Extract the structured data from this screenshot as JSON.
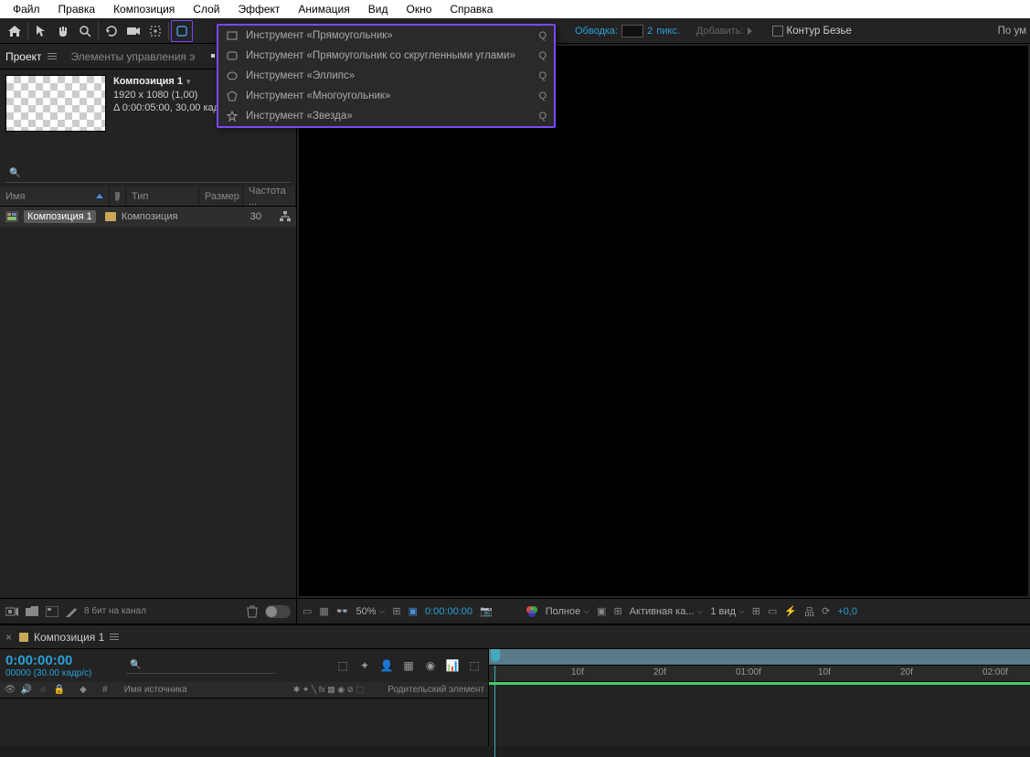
{
  "menubar": [
    "Файл",
    "Правка",
    "Композиция",
    "Слой",
    "Эффект",
    "Анимация",
    "Вид",
    "Окно",
    "Справка"
  ],
  "toolbar": {
    "stroke_label": "Обводка:",
    "stroke_value": "2",
    "stroke_unit": "пикс.",
    "add_label": "Добавить:",
    "bezier_checkbox": "Контур Безье",
    "right_hint": "По ум"
  },
  "shape_flyout": [
    {
      "icon": "rect",
      "label": "Инструмент «Прямоугольник»",
      "shortcut": "Q",
      "selected": false
    },
    {
      "icon": "roundrect",
      "label": "Инструмент «Прямоугольник со скругленными углами»",
      "shortcut": "Q",
      "selected": true
    },
    {
      "icon": "ellipse",
      "label": "Инструмент «Эллипс»",
      "shortcut": "Q",
      "selected": false
    },
    {
      "icon": "polygon",
      "label": "Инструмент «Многоугольник»",
      "shortcut": "Q",
      "selected": false
    },
    {
      "icon": "star",
      "label": "Инструмент «Звезда»",
      "shortcut": "Q",
      "selected": false
    }
  ],
  "panel": {
    "tab_project": "Проект",
    "tab_controls": "Элементы управления э",
    "comp": {
      "name": "Композиция 1",
      "dimensions": "1920 x 1080 (1,00)",
      "duration": "Δ 0:00:05:00, 30,00 кад"
    },
    "columns": {
      "name": "Имя",
      "type": "Тип",
      "size": "Размер",
      "rate": "Частота ..."
    },
    "item": {
      "name": "Композиция 1",
      "type": "Композиция",
      "rate": "30"
    },
    "footer_label": "8 бит на канал"
  },
  "viewer_footer": {
    "zoom": "50%",
    "time": "0:00:00:00",
    "quality": "Полное",
    "camera": "Активная ка...",
    "views": "1 вид",
    "exposure": "+0,0"
  },
  "timeline": {
    "tab_name": "Композиция 1",
    "time": "0:00:00:00",
    "time_sub": "00000 (30.00 кадр/с)",
    "col_hash": "#",
    "col_source": "Имя источника",
    "col_parent": "Родительский элемент",
    "ruler": [
      "10f",
      "20f",
      "01:00f",
      "10f",
      "20f",
      "02:00f"
    ]
  }
}
